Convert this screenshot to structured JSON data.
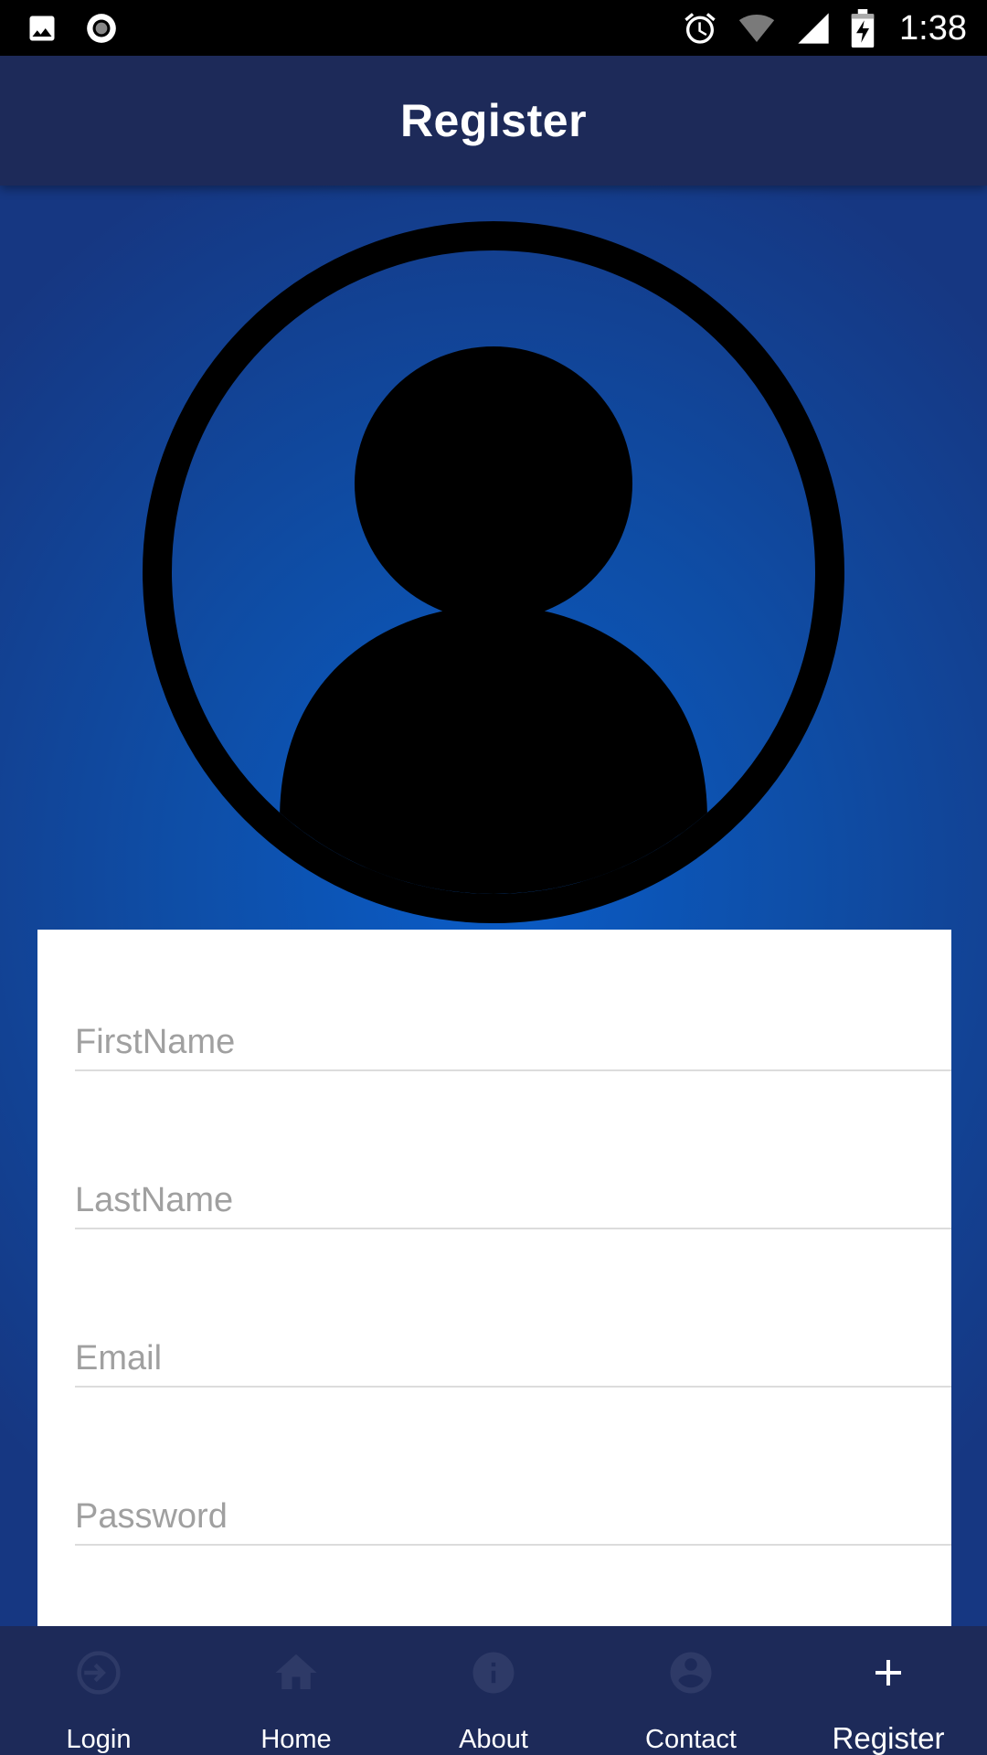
{
  "status_bar": {
    "time": "1:38",
    "icons": [
      "image-icon",
      "record-icon",
      "alarm-icon",
      "wifi-icon",
      "signal-icon",
      "battery-charging-icon"
    ]
  },
  "app_bar": {
    "title": "Register"
  },
  "avatar": {
    "icon": "user-avatar-icon"
  },
  "form": {
    "fields": [
      {
        "name": "first-name",
        "placeholder": "FirstName",
        "value": ""
      },
      {
        "name": "last-name",
        "placeholder": "LastName",
        "value": ""
      },
      {
        "name": "email",
        "placeholder": "Email",
        "value": ""
      },
      {
        "name": "password",
        "placeholder": "Password",
        "value": ""
      }
    ]
  },
  "bottom_nav": {
    "items": [
      {
        "label": "Login",
        "icon": "login-icon",
        "active": false
      },
      {
        "label": "Home",
        "icon": "home-icon",
        "active": false
      },
      {
        "label": "About",
        "icon": "info-icon",
        "active": false
      },
      {
        "label": "Contact",
        "icon": "account-circle-icon",
        "active": false
      },
      {
        "label": "Register",
        "icon": "plus-icon",
        "active": true
      }
    ]
  },
  "colors": {
    "app_bar": "#1d2a59",
    "background_center": "#0a5cc7",
    "background_edge": "#163782",
    "inactive_icon": "#2e3a67",
    "active_icon": "#ffffff",
    "placeholder": "#a0a0a0"
  }
}
